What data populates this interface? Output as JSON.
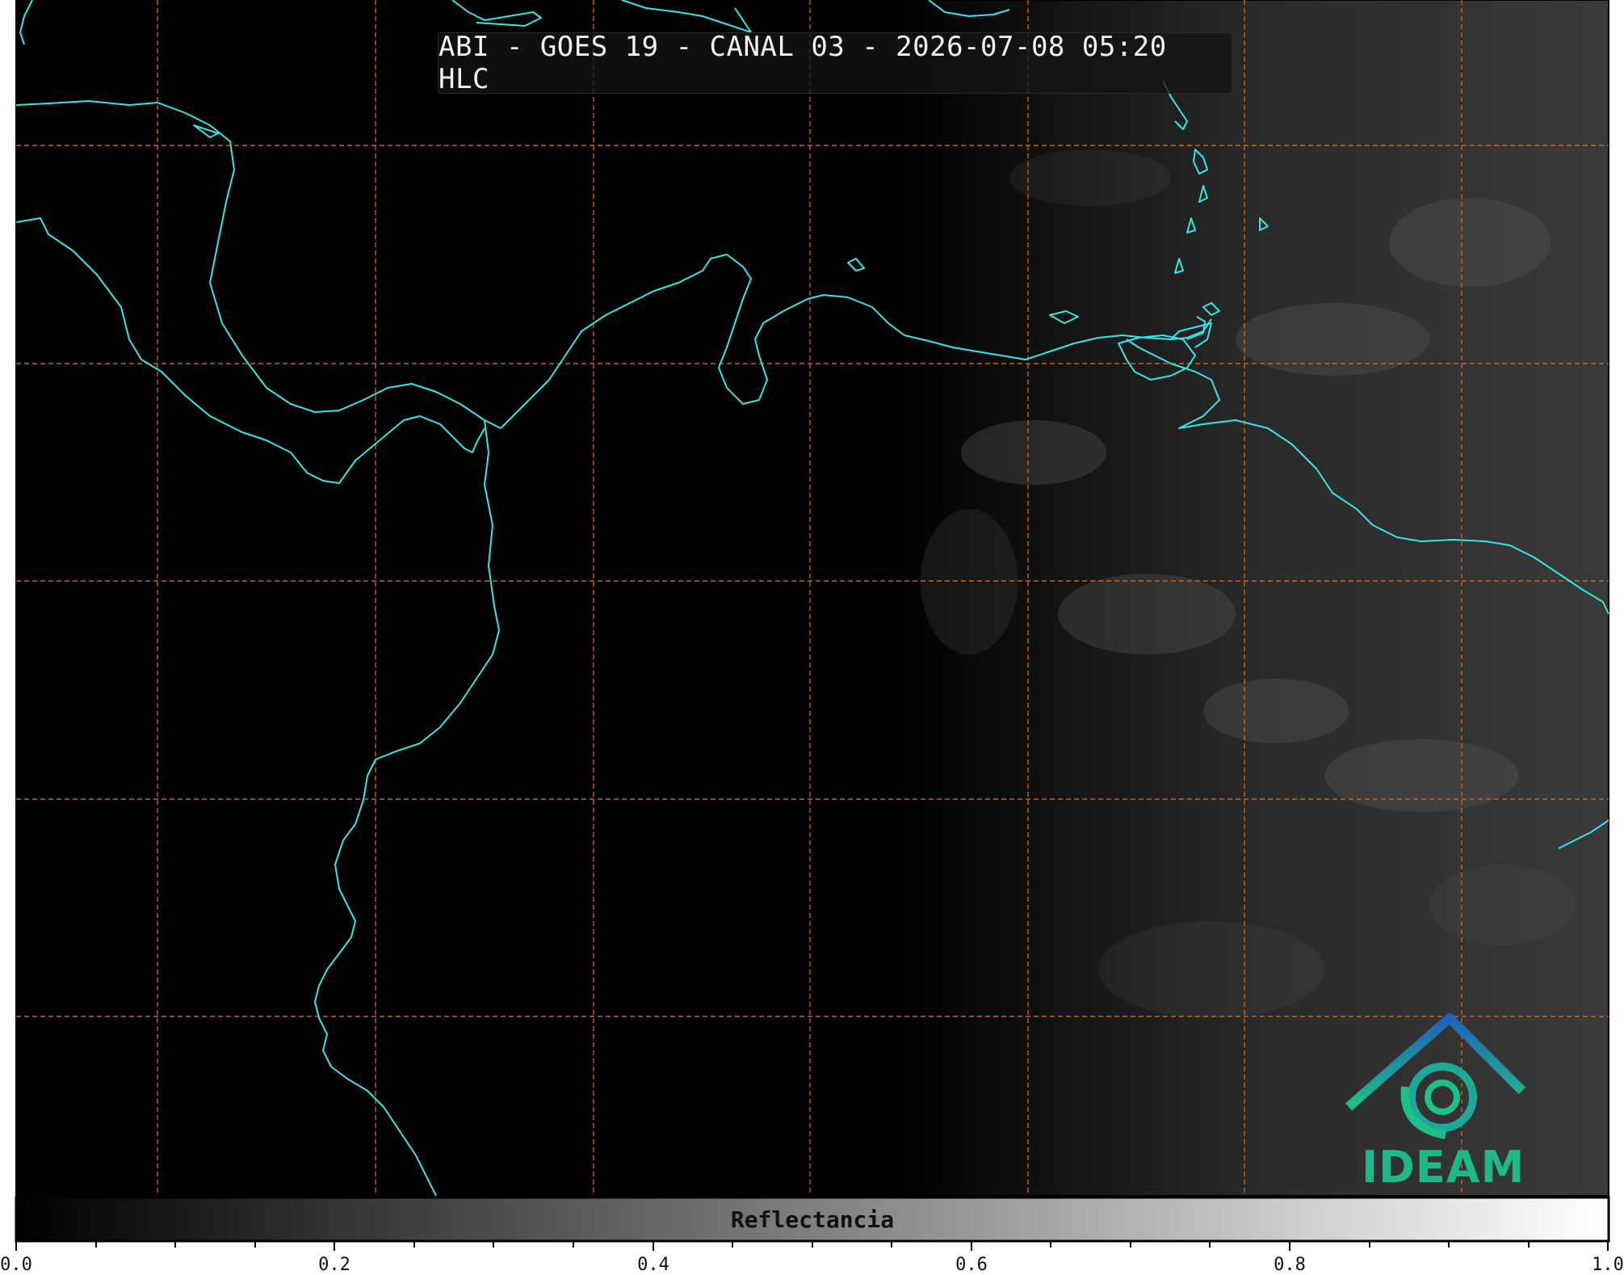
{
  "map": {
    "title": "ABI - GOES 19 - CANAL 03 - 2026-07-08 05:20 HLC",
    "channel": "CANAL 03",
    "satellite": "GOES 19",
    "coastline_color": "#35e6e6",
    "graticule_color": "#c8641e",
    "logo": {
      "icon": "ideam-logo-icon",
      "text": "IDEAM",
      "colors": [
        "#1f6fb8",
        "#1fb88a"
      ]
    }
  },
  "colorbar": {
    "label": "Reflectancia",
    "ticks": [
      "0.0",
      "0.2",
      "0.4",
      "0.6",
      "0.8",
      "1.0"
    ],
    "range": [
      0.0,
      1.0
    ],
    "colormap": [
      "#000000",
      "#ffffff"
    ]
  }
}
